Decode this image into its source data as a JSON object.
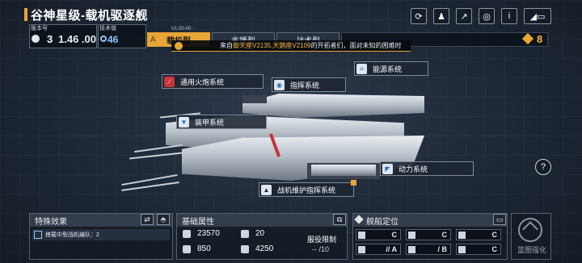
{
  "header": {
    "title": "谷神星级-载机驱逐舰",
    "version_label": "版本号",
    "version_number": "3",
    "version_value": "1.46 .00",
    "tech_label": "技术值",
    "tech_value": "46",
    "tab_id": "V1.00-00·",
    "tabs": [
      "载机型",
      "支援型",
      "战术型"
    ],
    "tab_prefix": "A",
    "resource_count": "8"
  },
  "banner": {
    "prefix": "来自",
    "highlight": "御天座V2135,天鹅座V2109",
    "suffix": "的开拓者们，面对未知的困难时"
  },
  "toolbar": {
    "icons": [
      "refresh-icon",
      "person-pin-icon",
      "share-icon",
      "capture-icon",
      "info-icon",
      "back-icon"
    ],
    "info_label": "i"
  },
  "systems": {
    "weapon": "通用火炮系统",
    "energy": "能源系统",
    "command": "指挥系统",
    "armor": "装甲系统",
    "power": "动力系统",
    "carrier": "战机维护指挥系统"
  },
  "help_label": "?",
  "special": {
    "title": "特殊效果",
    "effect": "搭载中型战机编队：2"
  },
  "basic": {
    "title": "基础属性",
    "hp": "23570",
    "armor": "20",
    "shield": "850",
    "speed": "4250",
    "deploy_label": "服役限制",
    "deploy_value": "-- /10"
  },
  "positioning": {
    "title": "舰船定位",
    "cells": [
      "C",
      "C",
      "C",
      "// A",
      "/ B",
      "C"
    ]
  },
  "enhance": {
    "label": "蓝图强化"
  },
  "colors": {
    "accent": "#e8a637",
    "tech_blue": "#8fc2ff",
    "alert_red": "#c9343b"
  }
}
